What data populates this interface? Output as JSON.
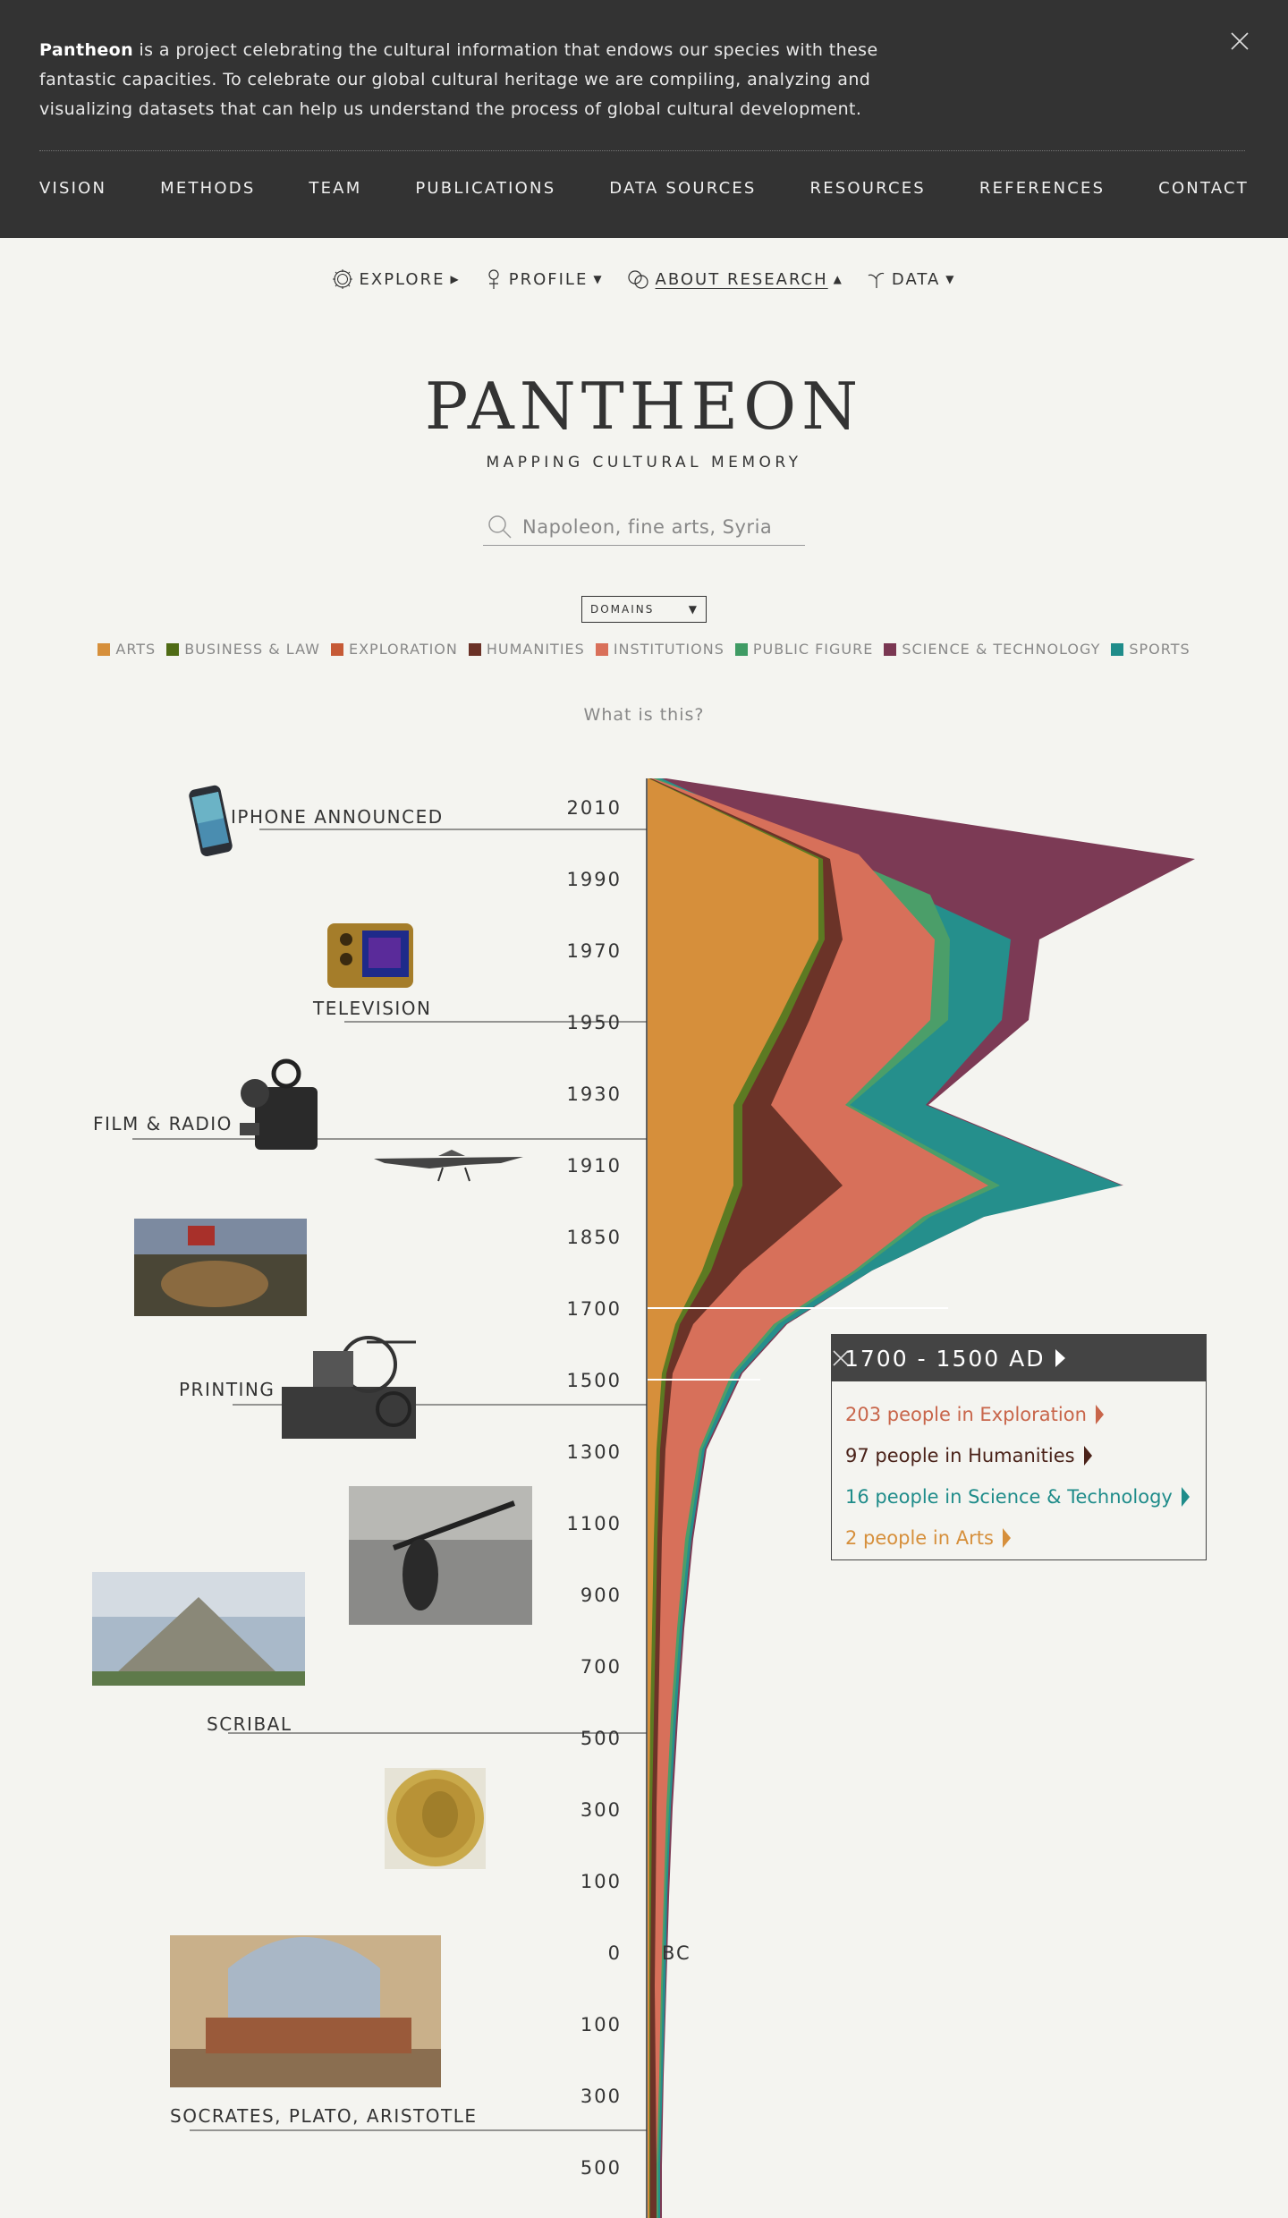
{
  "banner": {
    "intro_bold": "Pantheon",
    "intro_rest": " is a project celebrating the cultural information that endows our species with these fantastic capacities. To celebrate our global cultural heritage we are compiling, analyzing and visualizing datasets that can help us understand the process of global cultural development.",
    "nav": [
      "VISION",
      "METHODS",
      "TEAM",
      "PUBLICATIONS",
      "DATA SOURCES",
      "RESOURCES",
      "REFERENCES",
      "CONTACT"
    ]
  },
  "subnav": {
    "explore": "EXPLORE",
    "profile": "PROFILE",
    "about": "ABOUT RESEARCH",
    "data": "DATA"
  },
  "brand": {
    "logo": "PANTHEON",
    "tagline": "MAPPING CULTURAL MEMORY"
  },
  "search": {
    "placeholder": "Napoleon, fine arts, Syria"
  },
  "domains_select": {
    "label": "DOMAINS"
  },
  "legend": [
    {
      "label": "ARTS",
      "color": "#d68f3b"
    },
    {
      "label": "BUSINESS & LAW",
      "color": "#4f6b15"
    },
    {
      "label": "EXPLORATION",
      "color": "#c65a36"
    },
    {
      "label": "HUMANITIES",
      "color": "#6a3126"
    },
    {
      "label": "INSTITUTIONS",
      "color": "#d9705a"
    },
    {
      "label": "PUBLIC FIGURE",
      "color": "#3f9b64"
    },
    {
      "label": "SCIENCE & TECHNOLOGY",
      "color": "#7a3752"
    },
    {
      "label": "SPORTS",
      "color": "#1f8c8a"
    }
  ],
  "what_is_this": "What is this?",
  "timeline": {
    "year_labels": [
      "2010",
      "1990",
      "1970",
      "1950",
      "1930",
      "1910",
      "1850",
      "1700",
      "1500",
      "1300",
      "1100",
      "900",
      "700",
      "500",
      "300",
      "100",
      "0",
      "100",
      "300",
      "500"
    ],
    "bc_label": "BC",
    "events": {
      "iphone": "IPHONE ANNOUNCED",
      "television": "TELEVISION",
      "film": "FILM & RADIO",
      "printing": "PRINTING",
      "scribal": "SCRIBAL",
      "socrates": "SOCRATES, PLATO, ARISTOTLE"
    }
  },
  "tooltip": {
    "title": "1700 - 1500 AD",
    "items": [
      {
        "text": "203 people in Exploration",
        "color": "#c8654a"
      },
      {
        "text": "97 people in Humanities",
        "color": "#4a2219"
      },
      {
        "text": "16 people in Science & Technology",
        "color": "#1f8c8a"
      },
      {
        "text": "2 people in Arts",
        "color": "#d68f3b"
      }
    ]
  }
}
